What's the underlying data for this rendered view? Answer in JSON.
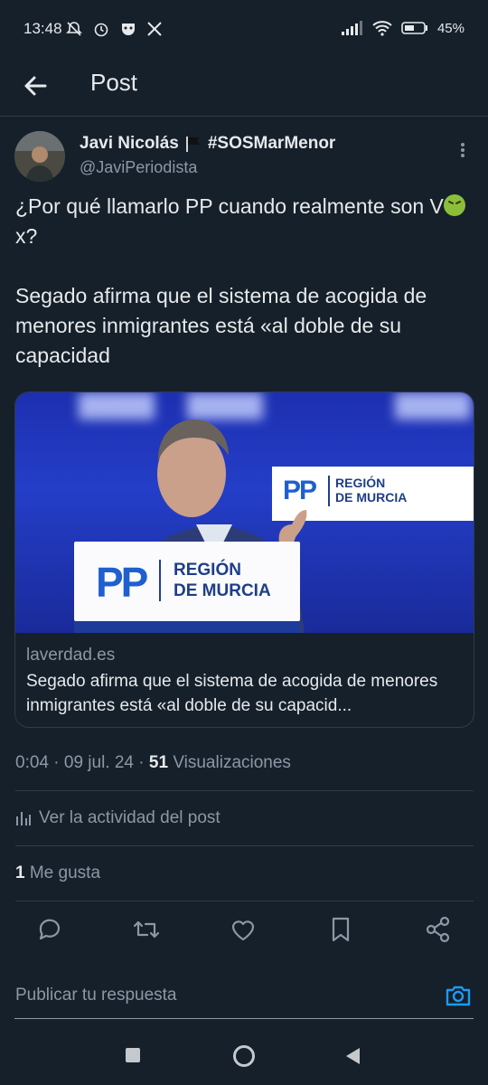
{
  "status_bar": {
    "time": "13:48",
    "battery": "45%"
  },
  "header": {
    "title": "Post"
  },
  "author": {
    "name": "Javi Nicolás",
    "tag": "#SOSMarMenor",
    "handle": "@JaviPeriodista"
  },
  "tweet": {
    "line1_part1": "¿Por qué llamarlo PP cuando realmente son V",
    "line1_part2": "x?",
    "paragraph2": "Segado afirma que el sistema de acogida de menores inmigrantes está «al doble de su capacidad"
  },
  "card": {
    "domain": "laverdad.es",
    "title": "Segado afirma que el sistema de acogida de menores inmigrantes está «al doble de su capacid...",
    "image_logo": "PP",
    "image_region": "REGIÓN",
    "image_region2": "DE MURCIA"
  },
  "meta": {
    "time": "0:04",
    "date": "09 jul. 24",
    "views_count": "51",
    "views_label": "Visualizaciones"
  },
  "activity_label": "Ver la actividad del post",
  "likes": {
    "count": "1",
    "label": "Me gusta"
  },
  "reply": {
    "placeholder": "Publicar tu respuesta"
  },
  "colors": {
    "background": "#15202b",
    "accent": "#1d9bf0",
    "muted": "#8b98a5"
  }
}
